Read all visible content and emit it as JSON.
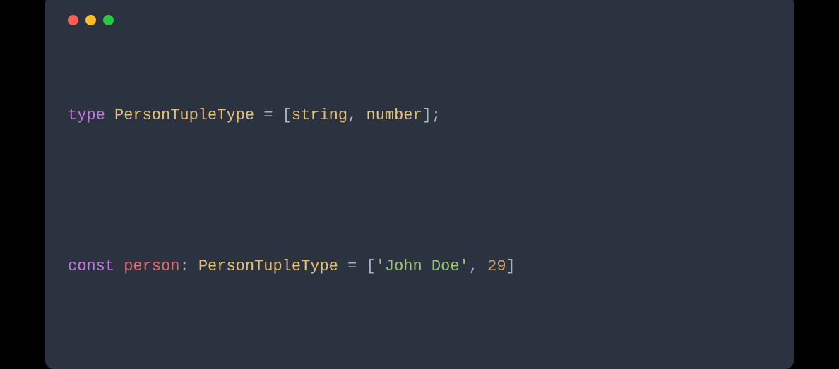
{
  "colors": {
    "background": "#000000",
    "windowBg": "#2b3340",
    "red": "#ff5f56",
    "yellow": "#ffbd2e",
    "green": "#27c93f",
    "keyword": "#c678dd",
    "type": "#e5c07b",
    "punct": "#abb2bf",
    "string": "#98c379",
    "number": "#d19a66",
    "variable": "#e06c75"
  },
  "code": {
    "line1": {
      "kw_type": "type",
      "sp1": " ",
      "typename": "PersonTupleType",
      "sp2": " ",
      "eq": "=",
      "sp3": " ",
      "lbracket": "[",
      "t_string": "string",
      "comma": ",",
      "sp4": " ",
      "t_number": "number",
      "rbracket_semi": "];"
    },
    "line2": {
      "kw_const": "const",
      "sp1": " ",
      "varname": "person",
      "colon": ":",
      "sp2": " ",
      "typename": "PersonTupleType",
      "sp3": " ",
      "eq": "=",
      "sp4": " ",
      "lbracket": "[",
      "str_val": "'John Doe'",
      "comma": ",",
      "sp5": " ",
      "num_val": "29",
      "rbracket": "]"
    }
  }
}
